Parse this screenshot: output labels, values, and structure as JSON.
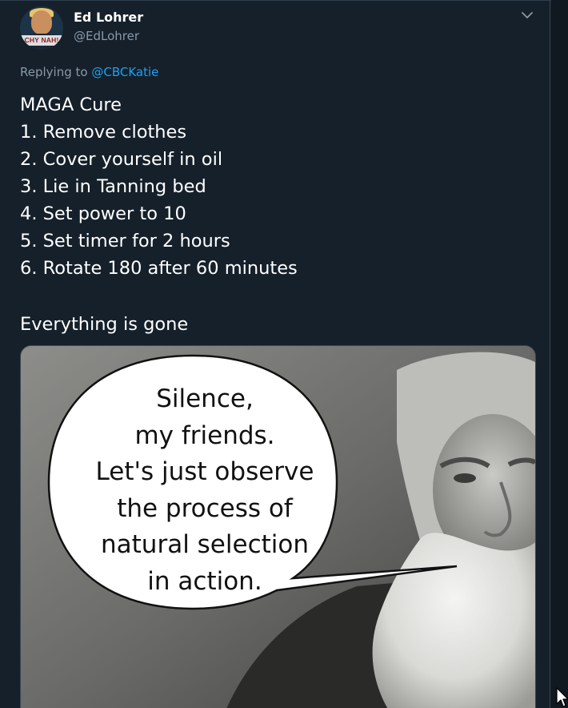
{
  "tweet": {
    "author": {
      "display_name": "Ed Lohrer",
      "handle": "@EdLohrer",
      "avatar_text": "CHY NAH!"
    },
    "reply_prefix": "Replying to",
    "reply_to": "@CBCKatie",
    "lines": [
      "MAGA Cure",
      "1. Remove clothes",
      "2. Cover yourself in oil",
      "3. Lie in Tanning bed",
      "4. Set power to 10",
      "5. Set timer for 2 hours",
      "6. Rotate 180 after 60 minutes"
    ],
    "closing_line": "Everything is gone",
    "image": {
      "speech_bubble": [
        "Silence,",
        "my friends.",
        "Let's just observe",
        "the process of",
        "natural selection",
        "in action."
      ]
    }
  },
  "icons": {
    "menu": "chevron-down-icon",
    "pointer": "mouse-cursor-icon"
  },
  "colors": {
    "background": "#15202b",
    "text_primary": "#ffffff",
    "text_secondary": "#8899a6",
    "link": "#1da1f2"
  }
}
